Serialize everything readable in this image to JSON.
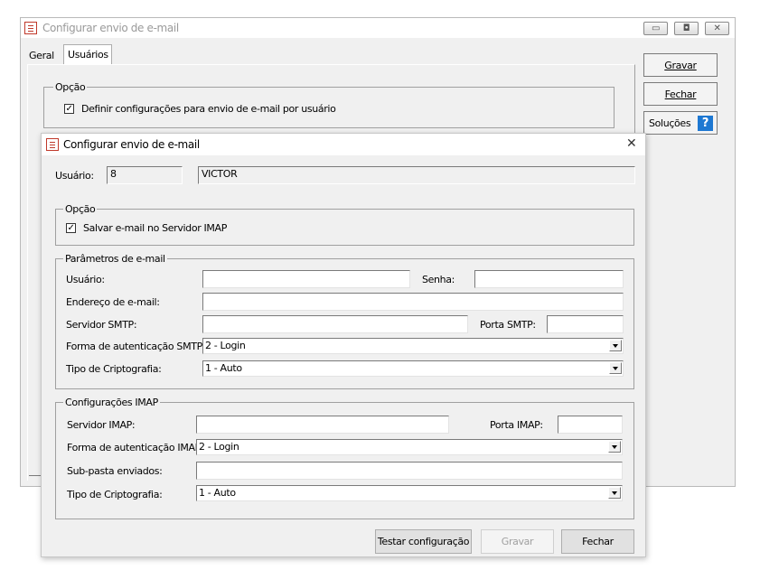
{
  "outer_window": {
    "title": "Configurar envio de e-mail",
    "tabs": [
      "Geral",
      "Usuários"
    ],
    "option_group": {
      "title": "Opção",
      "checkbox_label": "Definir configurações para envio de e-mail por usuário",
      "checked": true
    },
    "buttons": {
      "gravar": "Gravar",
      "fechar": "Fechar",
      "solucoes": "Soluções"
    }
  },
  "dialog": {
    "title": "Configurar envio de e-mail",
    "close_glyph": "✕",
    "user_label": "Usuário:",
    "user_code": "8",
    "user_name": "VICTOR",
    "option_group": {
      "title": "Opção",
      "checkbox_label": "Salvar e-mail no Servidor IMAP",
      "checked": true
    },
    "email_params": {
      "title": "Parâmetros de e-mail",
      "usuario_label": "Usuário:",
      "usuario_value": "",
      "senha_label": "Senha:",
      "senha_value": "",
      "endereco_label": "Endereço de e-mail:",
      "endereco_value": "",
      "smtp_label": "Servidor SMTP:",
      "smtp_value": "",
      "porta_smtp_label": "Porta SMTP:",
      "porta_smtp_value": "",
      "auth_smtp_label": "Forma de autenticação SMTP:",
      "auth_smtp_value": "2 - Login",
      "cripto_label": "Tipo de Criptografia:",
      "cripto_value": "1 - Auto"
    },
    "imap": {
      "title": "Configurações IMAP",
      "servidor_label": "Servidor IMAP:",
      "servidor_value": "",
      "porta_label": "Porta IMAP:",
      "porta_value": "",
      "auth_label": "Forma de autenticação IMAP:",
      "auth_value": "2 - Login",
      "subpasta_label": "Sub-pasta enviados:",
      "subpasta_value": "",
      "cripto_label": "Tipo de Criptografia:",
      "cripto_value": "1 - Auto"
    },
    "buttons": {
      "testar": "Testar configuração",
      "gravar": "Gravar",
      "fechar": "Fechar"
    }
  }
}
